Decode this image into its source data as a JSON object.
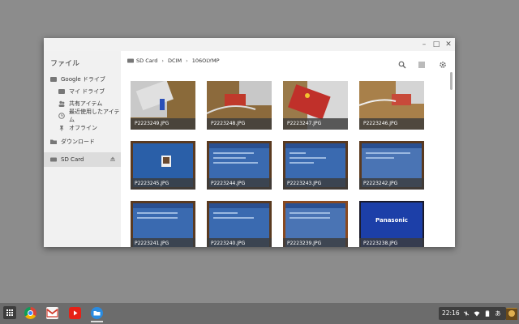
{
  "window": {
    "controls": {
      "minimize": "–",
      "maximize": "□",
      "close": "✕"
    }
  },
  "sidebar": {
    "title": "ファイル",
    "items": [
      {
        "label": "Google ドライブ",
        "icon": "drive-icon"
      },
      {
        "label": "マイ ドライブ",
        "icon": "my-drive-icon"
      },
      {
        "label": "共有アイテム",
        "icon": "shared-icon"
      },
      {
        "label": "最近使用したアイテム",
        "icon": "clock-icon"
      },
      {
        "label": "オフライン",
        "icon": "pin-icon"
      },
      {
        "label": "ダウンロード",
        "icon": "download-folder-icon"
      },
      {
        "label": "SD Card",
        "icon": "sd-card-icon"
      }
    ]
  },
  "breadcrumb": [
    "SD Card",
    "DCIM",
    "106OLYMP"
  ],
  "breadcrumb_sep": "›",
  "files": [
    {
      "name": "P2223249.JPG"
    },
    {
      "name": "P2223248.JPG"
    },
    {
      "name": "P2223247.JPG"
    },
    {
      "name": "P2223246.JPG"
    },
    {
      "name": "P2223245.JPG"
    },
    {
      "name": "P2223244.JPG"
    },
    {
      "name": "P2223243.JPG"
    },
    {
      "name": "P2223242.JPG"
    },
    {
      "name": "P2223241.JPG"
    },
    {
      "name": "P2223240.JPG"
    },
    {
      "name": "P2223239.JPG"
    },
    {
      "name": "P2223238.JPG"
    }
  ],
  "panasonic_text": "Panasonic",
  "status": {
    "time": "22:16",
    "ime": "あ"
  },
  "colors": {
    "accent": "#1a73e8",
    "screen_blue": "#1e4fa0",
    "sidebar_bg": "#f1f1f1"
  }
}
